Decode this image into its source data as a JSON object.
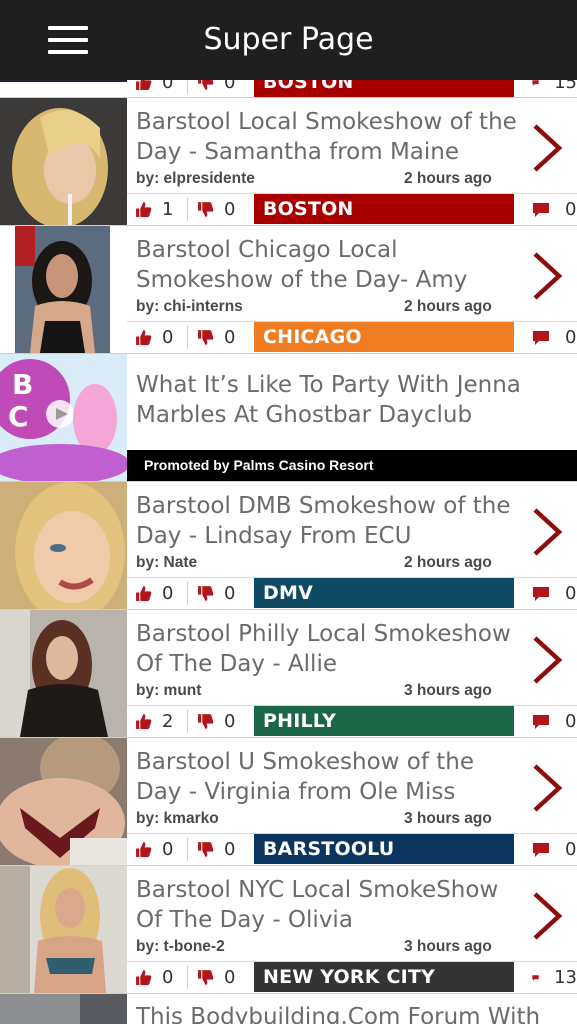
{
  "header": {
    "title": "Super Page"
  },
  "colors": {
    "boston": "#a80000",
    "chicago": "#f07d21",
    "dmv": "#0e4a63",
    "philly": "#1a6647",
    "barstoolu": "#0b355f",
    "nyc": "#343434",
    "icon": "#b0171b"
  },
  "partial_top": {
    "likes": "0",
    "dislikes": "0",
    "tag": "BOSTON",
    "comments": "15"
  },
  "posts": [
    {
      "title": "Barstool Local Smokeshow of the Day - Samantha from Maine",
      "byline": "by: elpresidente",
      "time": "2 hours ago",
      "likes": "1",
      "dislikes": "0",
      "tag": "BOSTON",
      "comments": "0"
    },
    {
      "title": "Barstool Chicago Local Smokeshow of the Day- Amy",
      "byline": "by: chi-interns",
      "time": "2 hours ago",
      "likes": "0",
      "dislikes": "0",
      "tag": "CHICAGO",
      "comments": "0"
    },
    {
      "title": "Barstool DMB Smokeshow of the Day - Lindsay From ECU",
      "byline": "by: Nate",
      "time": "2 hours ago",
      "likes": "0",
      "dislikes": "0",
      "tag": "DMV",
      "comments": "0"
    },
    {
      "title": "Barstool Philly Local Smokeshow Of The Day - Allie",
      "byline": "by: munt",
      "time": "3 hours ago",
      "likes": "2",
      "dislikes": "0",
      "tag": "PHILLY",
      "comments": "0"
    },
    {
      "title": "Barstool U Smokeshow of the Day - Virginia from Ole Miss",
      "byline": "by: kmarko",
      "time": "3 hours ago",
      "likes": "0",
      "dislikes": "0",
      "tag": "BARSTOOLU",
      "comments": "0"
    },
    {
      "title": "Barstool NYC Local SmokeShow Of The Day - Olivia",
      "byline": "by: t-bone-2",
      "time": "3 hours ago",
      "likes": "0",
      "dislikes": "0",
      "tag": "NEW YORK CITY",
      "comments": "13"
    }
  ],
  "promo": {
    "title": "What It’s Like To Party With Jenna Marbles At Ghostbar Dayclub",
    "sponsor": "Promoted by Palms Casino Resort"
  },
  "last_post": {
    "title": "This Bodybuilding.Com Forum With"
  }
}
